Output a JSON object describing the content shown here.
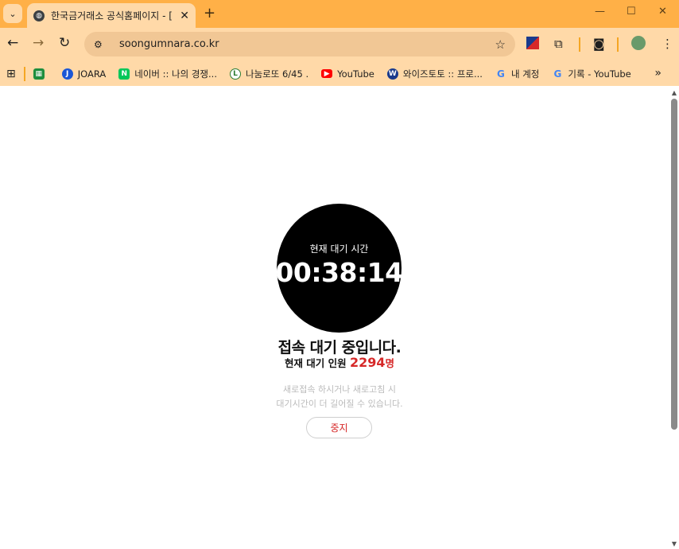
{
  "browser": {
    "tab_title": "한국금거래소 공식홈페이지 - [",
    "url": "soongumnara.co.kr",
    "bookmarks": [
      {
        "label": "",
        "icon": "google-sheets-icon"
      },
      {
        "label": "JOARA",
        "icon": "joara-icon"
      },
      {
        "label": "네이버 :: 나의 경쟁...",
        "icon": "naver-icon"
      },
      {
        "label": "나눔로또 6/45 .",
        "icon": "lotto-icon"
      },
      {
        "label": "YouTube",
        "icon": "youtube-icon"
      },
      {
        "label": "와이즈토토 :: 프로...",
        "icon": "wisetoto-icon"
      },
      {
        "label": "내 계정",
        "icon": "google-icon"
      },
      {
        "label": "기록 - YouTube",
        "icon": "google-icon"
      }
    ]
  },
  "queue": {
    "circle_label": "현재 대기 시간",
    "wait_time": "00:38:14",
    "headline": "접속 대기 중입니다.",
    "count_prefix": "현재 대기 인원",
    "count_value": "2294",
    "count_unit": "명",
    "notice_line1": "새로접속 하시거나 새로고침 시",
    "notice_line2": "대기시간이 더 길어질 수 있습니다.",
    "stop_label": "중지"
  },
  "colors": {
    "tabstrip": "#ffb047",
    "toolbar": "#ffd9a8",
    "accent_red": "#d62828"
  }
}
